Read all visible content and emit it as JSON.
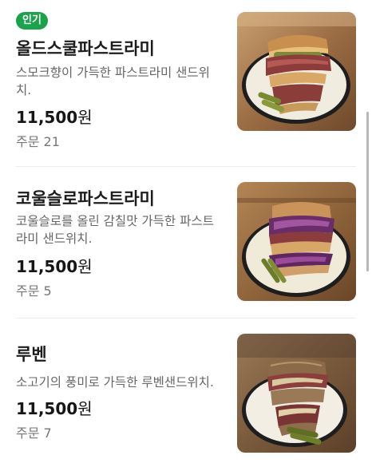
{
  "menu": {
    "items": [
      {
        "badge": "인기",
        "name": "올드스쿨파스트라미",
        "description": "스모크향이 가득한 파스트라미 샌드위치.",
        "price": "11,500",
        "currency": "원",
        "orders_label": "주문",
        "orders_count": "21",
        "image_icon": "pastrami-sandwich-image"
      },
      {
        "name": "코울슬로파스트라미",
        "description": "코울슬로를 올린 감칠맛 가득한 파스트라미 샌드위치.",
        "price": "11,500",
        "currency": "원",
        "orders_label": "주문",
        "orders_count": "5",
        "image_icon": "coleslaw-pastrami-sandwich-image"
      },
      {
        "name": "루벤",
        "description": "소고기의 풍미로 가득한 루벤샌드위치.",
        "price": "11,500",
        "currency": "원",
        "orders_label": "주문",
        "orders_count": "7",
        "image_icon": "reuben-sandwich-image"
      }
    ]
  },
  "colors": {
    "badge_green": "#19a34a",
    "text_primary": "#1c1c1c",
    "text_secondary": "#666666",
    "divider": "#ececec"
  }
}
